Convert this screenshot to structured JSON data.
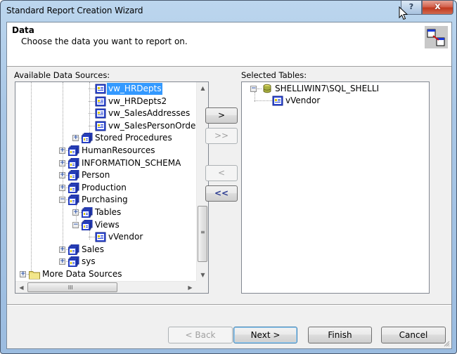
{
  "window": {
    "title": "Standard Report Creation Wizard",
    "help_label": "?",
    "close_label": "x"
  },
  "header": {
    "title": "Data",
    "subtitle": "Choose the data you want to report on."
  },
  "available": {
    "label": "Available Data Sources:",
    "items": [
      {
        "label": "vw_HRDepts",
        "selected": true,
        "icon": "view-icon"
      },
      {
        "label": "vw_HRDepts2",
        "icon": "view-icon"
      },
      {
        "label": "vw_SalesAddresses",
        "icon": "view-icon"
      },
      {
        "label": "vw_SalesPersonOrders",
        "icon": "view-icon"
      },
      {
        "label": "Stored Procedures",
        "expander": "+",
        "icon": "folder-stack-icon"
      },
      {
        "label": "HumanResources",
        "expander": "+",
        "icon": "schema-icon"
      },
      {
        "label": "INFORMATION_SCHEMA",
        "expander": "+",
        "icon": "schema-icon"
      },
      {
        "label": "Person",
        "expander": "+",
        "icon": "schema-icon"
      },
      {
        "label": "Production",
        "expander": "+",
        "icon": "schema-icon"
      },
      {
        "label": "Purchasing",
        "expander": "−",
        "icon": "schema-icon"
      },
      {
        "label": "Tables",
        "expander": "+",
        "icon": "folder-stack-icon"
      },
      {
        "label": "Views",
        "expander": "−",
        "icon": "folder-stack-icon"
      },
      {
        "label": "vVendor",
        "icon": "view-icon"
      },
      {
        "label": "Sales",
        "expander": "+",
        "icon": "schema-icon"
      },
      {
        "label": "sys",
        "expander": "+",
        "icon": "schema-icon"
      },
      {
        "label": "More Data Sources",
        "expander": "+",
        "icon": "folder-icon"
      }
    ],
    "hscroll_grip": "III",
    "vscroll_grip": "≡"
  },
  "transfer_buttons": {
    "add": ">",
    "add_all": ">>",
    "remove": "<",
    "remove_all": "<<"
  },
  "selected": {
    "label": "Selected Tables:",
    "items": [
      {
        "label": "SHELLIWIN7\\SQL_SHELLI",
        "expander": "−",
        "icon": "database-icon"
      },
      {
        "label": "vVendor",
        "icon": "view-icon"
      }
    ]
  },
  "footer": {
    "back": "< Back",
    "next": "Next >",
    "finish": "Finish",
    "cancel": "Cancel"
  },
  "colors": {
    "selection": "#3399ff",
    "view_icon_blue": "#1e3cc8",
    "close_red": "#c0391f"
  }
}
